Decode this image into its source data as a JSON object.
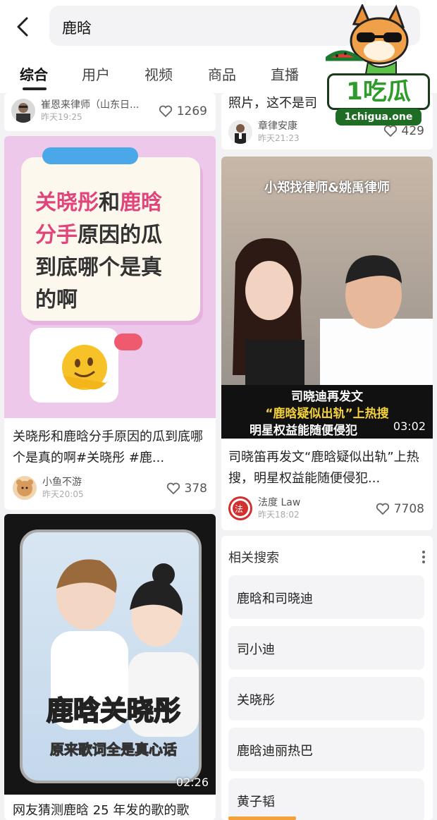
{
  "search": {
    "query": "鹿晗"
  },
  "tabs": [
    "综合",
    "用户",
    "视频",
    "商品",
    "直播"
  ],
  "watermark": {
    "brand": "1吃瓜",
    "domain": "1chigua.one"
  },
  "left": {
    "top_card": {
      "author": "崔恩来律师（山东日...",
      "time": "昨天19:25",
      "likes": "1269"
    },
    "card1": {
      "cover_lines_pink": [
        "关晓彤",
        "鹿晗",
        "分手"
      ],
      "cover_text": "关晓彤和鹿晗分手原因的瓜到底哪个是真的啊",
      "cover_line1": [
        "关晓彤",
        "和",
        "鹿晗"
      ],
      "cover_line2": [
        "分手",
        "原因的瓜"
      ],
      "cover_line3": "到底哪个是真",
      "cover_line4": "的啊",
      "title": "关晓彤和鹿晗分手原因的瓜到底哪个是真的啊#关晓彤 #鹿...",
      "author": "小鱼不游",
      "time": "昨天20:05",
      "likes": "378"
    },
    "card2": {
      "cover_big": "鹿晗关晓彤",
      "cover_sub": "原来歌词全是真心话",
      "duration": "02:26",
      "title": "网友猜测鹿晗 25 年发的歌的歌"
    }
  },
  "right": {
    "top_card": {
      "title_tail": "照片，这不是司",
      "author": "章律安康",
      "time": "昨天21:23",
      "likes": "429"
    },
    "card1": {
      "cover_top": "小郑找律师&姚禹律师",
      "caption1": "司晓迪再发文",
      "caption2": "“鹿晗疑似出轨”上热搜",
      "caption3": "明星权益能随便侵犯",
      "duration": "03:02",
      "title": "司晓笛再发文“鹿晗疑似出轨”上热搜，明星权益能随便侵犯...",
      "author": "法度 Law",
      "time": "昨天18:02",
      "likes": "7708"
    },
    "related": {
      "heading": "相关搜索",
      "items": [
        "鹿晗和司晓迪",
        "司小迪",
        "关晓彤",
        "鹿晗迪丽热巴",
        "黄子韬"
      ]
    }
  },
  "colors": {
    "pink_cover": "#ecc6e8",
    "pink_text": "#e0447a",
    "accent": "#f2a23a"
  }
}
